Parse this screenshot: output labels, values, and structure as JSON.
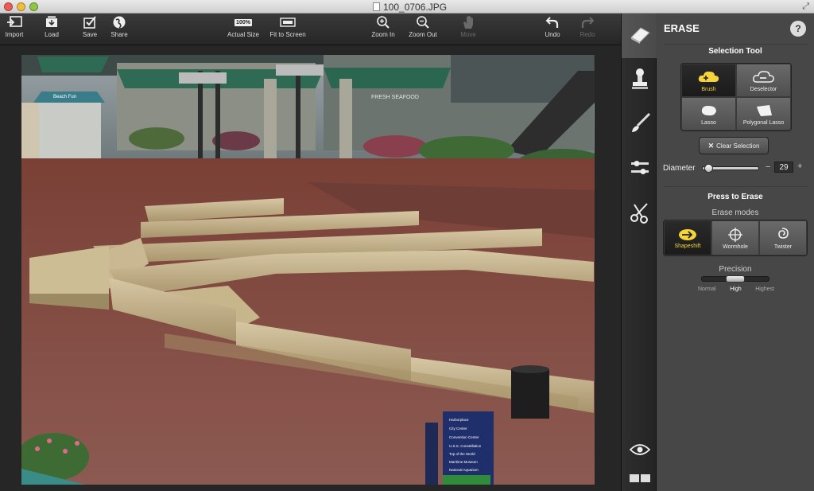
{
  "window": {
    "title": "100_0706.JPG"
  },
  "toolbar": {
    "import": "Import",
    "load": "Load",
    "save": "Save",
    "share": "Share",
    "actual_size": "Actual Size",
    "actual_size_badge": "100%",
    "fit_to_screen": "Fit to Screen",
    "zoom_in": "Zoom In",
    "zoom_out": "Zoom Out",
    "move": "Move",
    "undo": "Undo",
    "redo": "Redo"
  },
  "panel": {
    "title": "ERASE",
    "help": "?",
    "selection_tool": {
      "heading": "Selection Tool",
      "tools": [
        "Brush",
        "Deselector",
        "Lasso",
        "Polygonal Lasso"
      ],
      "active": "Brush"
    },
    "clear_selection": "Clear Selection",
    "diameter": {
      "label": "Diameter",
      "value": "29",
      "minus": "−",
      "plus": "+"
    },
    "press_to_erase": "Press to Erase",
    "erase_modes": {
      "heading": "Erase modes",
      "modes": [
        "Shapeshift",
        "Wormhole",
        "Twister"
      ],
      "active": "Shapeshift"
    },
    "precision": {
      "heading": "Precision",
      "levels": [
        "Normal",
        "High",
        "Highest"
      ],
      "selected": "High"
    }
  },
  "photo": {
    "sign_lines": [
      "Harborplace",
      "City Center",
      "Convention Center",
      "U.S.S. Constellation",
      "Top of the World",
      "Maritime Museum",
      "National Aquarium"
    ],
    "awning_text": "FRESH SEAFOOD",
    "kiosk_text": "Beach Fun"
  },
  "colors": {
    "accent": "#f5d33a",
    "panel": "#474747",
    "toolbar": "#2e2e2e"
  }
}
